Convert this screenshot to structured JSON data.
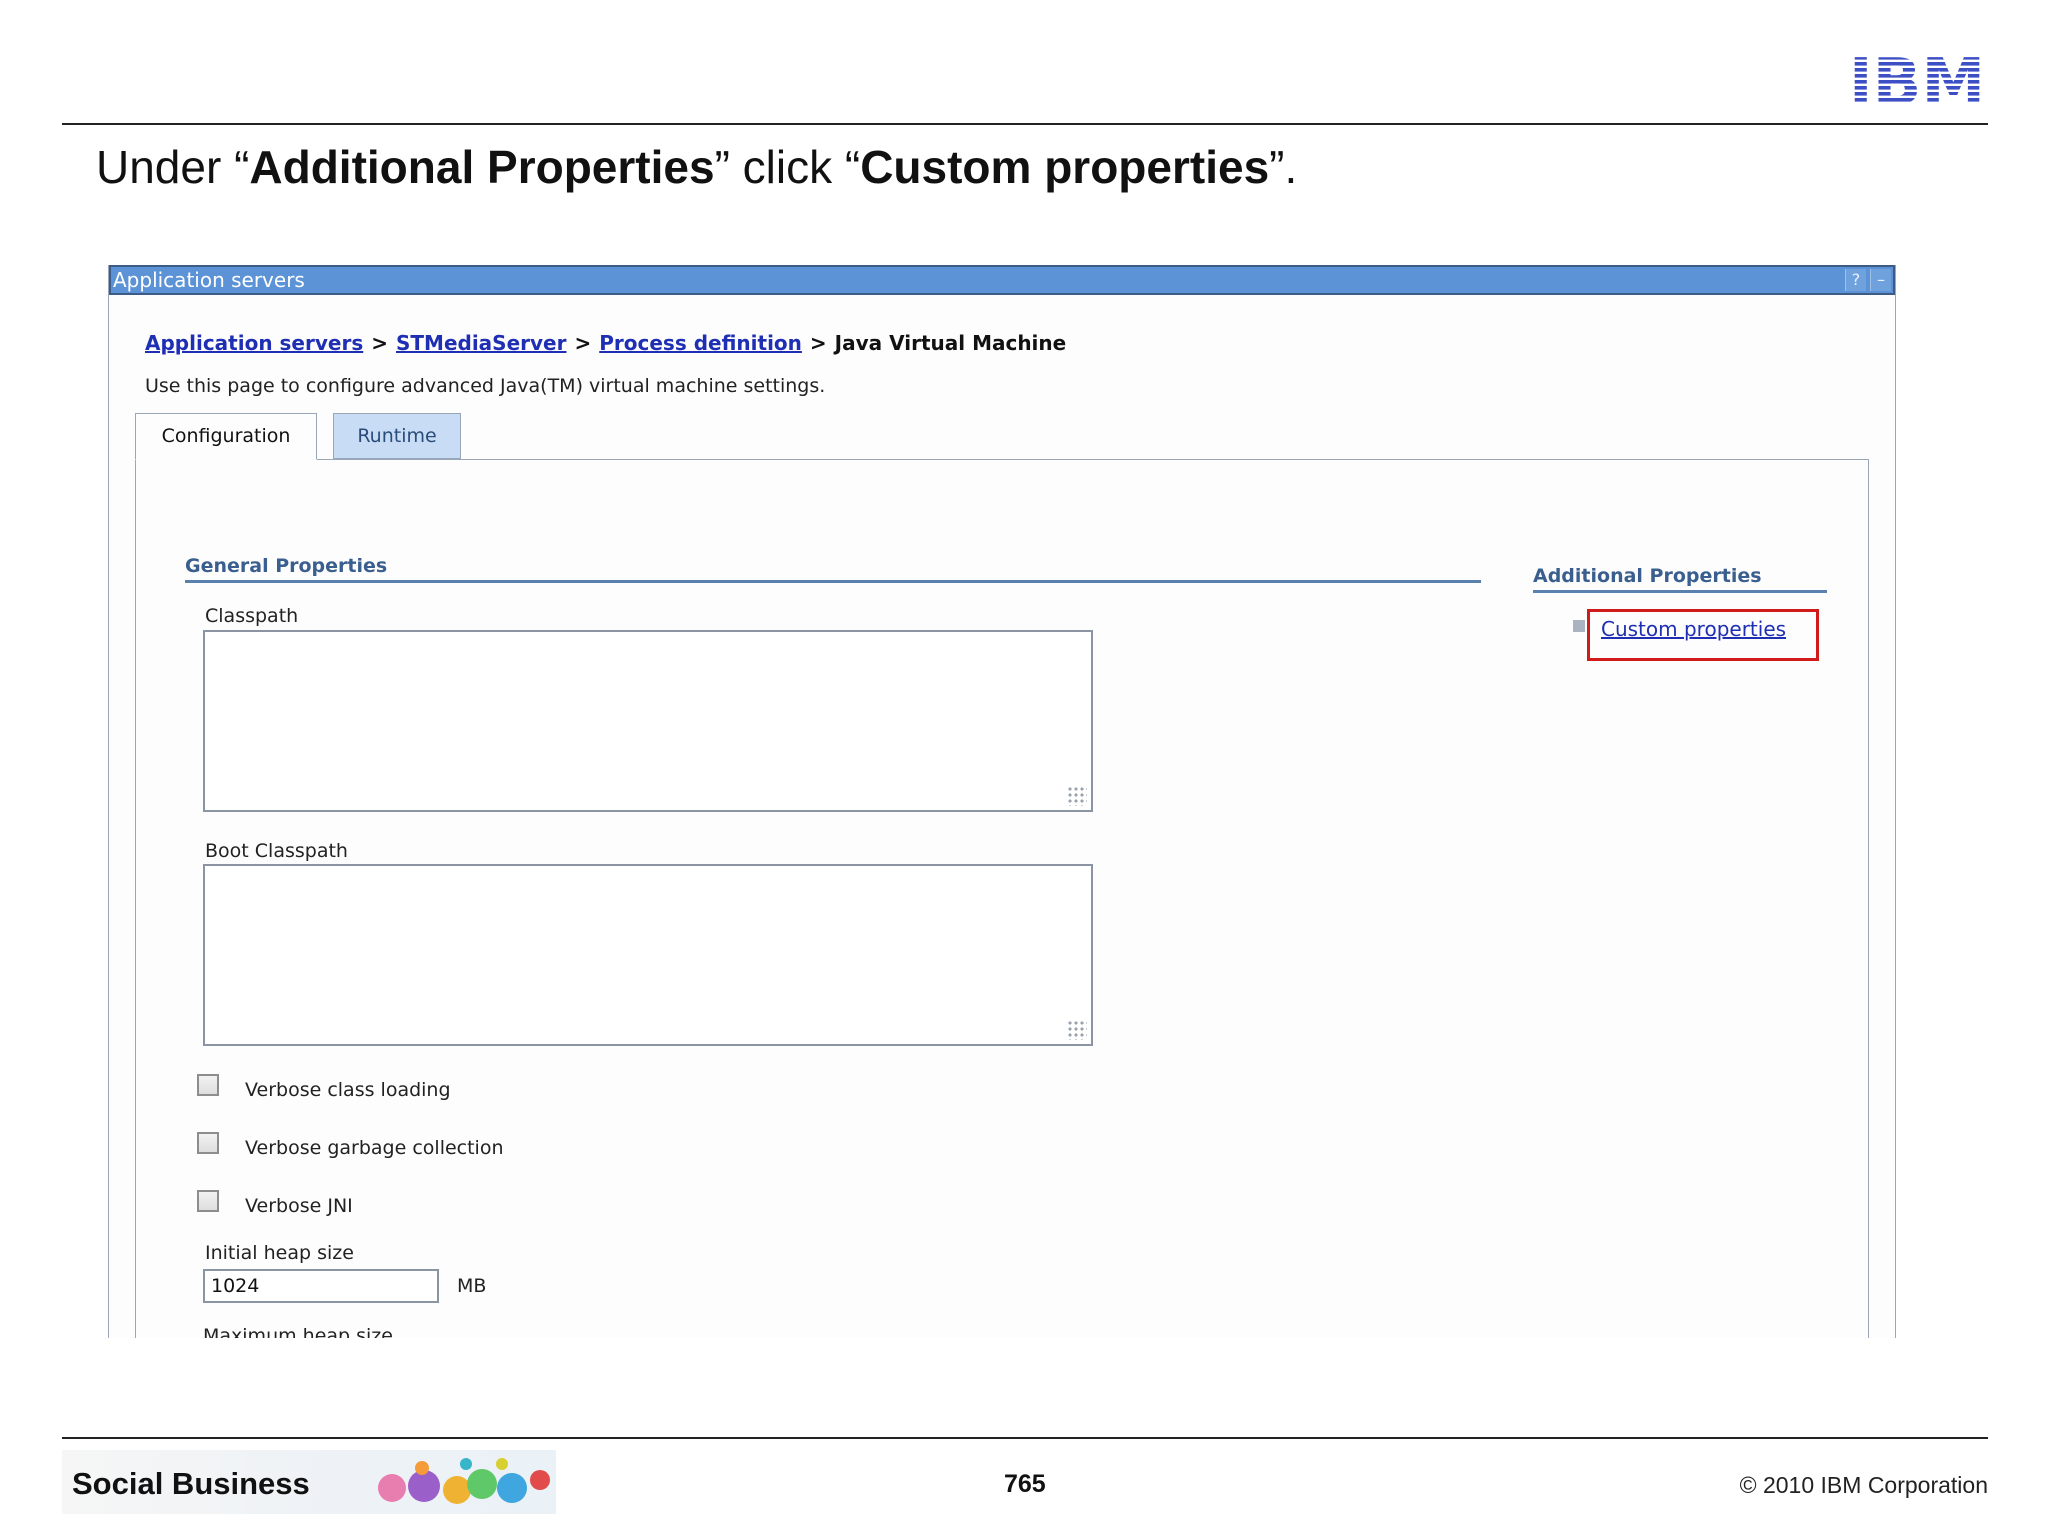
{
  "slide": {
    "instruction": {
      "p1": "Under “",
      "b1": "Additional Properties",
      "p2": "” click “",
      "b2": "Custom properties",
      "p3": "”."
    },
    "logo_text": "IBM",
    "footer": {
      "brand": "Social Business",
      "page_number": "765",
      "copyright": "© 2010 IBM Corporation"
    }
  },
  "window": {
    "title": "Application servers",
    "help_button": "?",
    "minimize_button": "–"
  },
  "breadcrumb": {
    "links": [
      "Application servers",
      "STMediaServer",
      "Process definition"
    ],
    "separator": ">",
    "current": "Java Virtual Machine"
  },
  "description": "Use this page to configure advanced Java(TM) virtual machine settings.",
  "tabs": [
    {
      "label": "Configuration",
      "active": true
    },
    {
      "label": "Runtime",
      "active": false
    }
  ],
  "general_properties": {
    "title": "General Properties",
    "classpath_label": "Classpath",
    "classpath_value": "",
    "boot_classpath_label": "Boot Classpath",
    "boot_classpath_value": "",
    "checkboxes": [
      {
        "label": "Verbose class loading",
        "checked": false
      },
      {
        "label": "Verbose garbage collection",
        "checked": false
      },
      {
        "label": "Verbose JNI",
        "checked": false
      }
    ],
    "initial_heap_label": "Initial heap size",
    "initial_heap_value": "1024",
    "initial_heap_unit": "MB",
    "max_heap_label": "Maximum heap size"
  },
  "additional_properties": {
    "title": "Additional Properties",
    "links": [
      "Custom properties"
    ],
    "highlight_color": "#d11a1a"
  },
  "colors": {
    "titlebar": "#5b93d6",
    "link": "#1f2fb3",
    "section_title": "#3a5f8f"
  }
}
